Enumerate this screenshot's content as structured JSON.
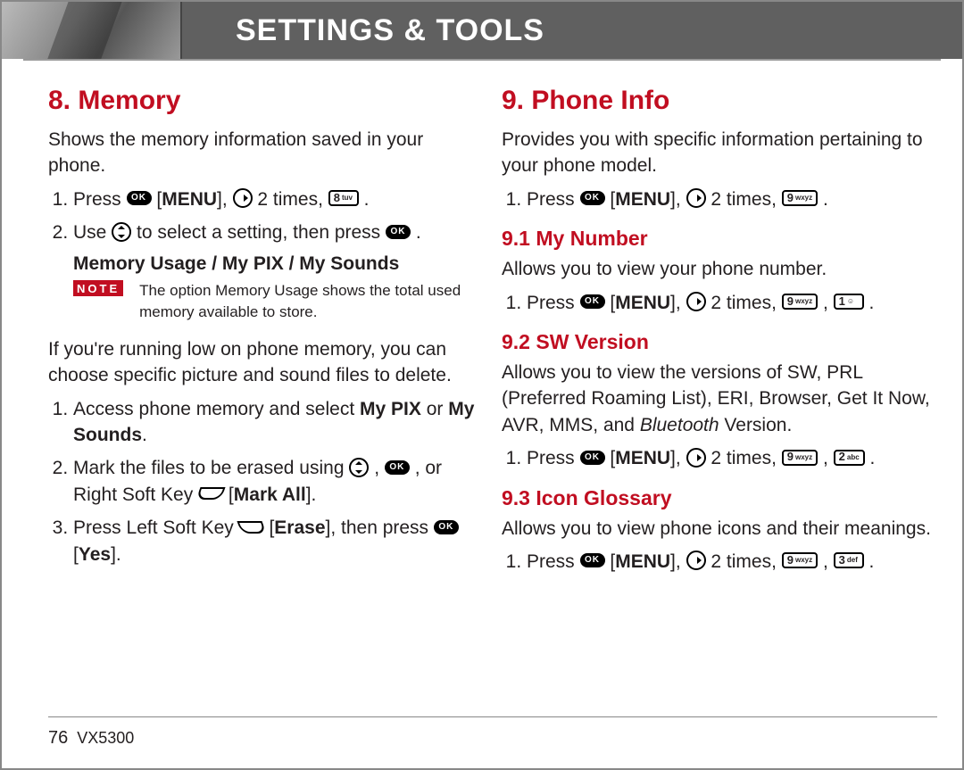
{
  "header": {
    "title": "SETTINGS & TOOLS"
  },
  "footer": {
    "page": "76",
    "model": "VX5300"
  },
  "keys": {
    "ok": "OK",
    "k8": {
      "digit": "8",
      "letters": "tuv"
    },
    "k9": {
      "digit": "9",
      "letters": "wxyz"
    },
    "k1": {
      "digit": "1",
      "letters": ""
    },
    "k2": {
      "digit": "2",
      "letters": "abc"
    },
    "k3": {
      "digit": "3",
      "letters": "def"
    }
  },
  "left": {
    "h": "8. Memory",
    "intro": "Shows the memory information saved in your phone.",
    "s1_a": "Press ",
    "s1_b": " [",
    "s1_menu": "MENU",
    "s1_c": "],   ",
    "s1_d": "  2 times,  ",
    "s1_e": " .",
    "s2_a": "Use  ",
    "s2_b": "  to select a setting, then press ",
    "s2_c": " .",
    "opts": "Memory Usage / My PIX / My Sounds",
    "note_label": "NOTE",
    "note": "The option Memory Usage shows the total used memory available to store.",
    "lowmem": "If you're running low on phone memory, you can choose specific picture and sound files to delete.",
    "d1_a": "Access phone memory and select ",
    "d1_b": "My PIX",
    "d1_c": " or ",
    "d1_d": "My Sounds",
    "d1_e": ".",
    "d2_a": "Mark the files to be erased using  ",
    "d2_b": " ,  ",
    "d2_c": " , or Right Soft Key ",
    "d2_d": " [",
    "d2_mark": "Mark All",
    "d2_e": "].",
    "d3_a": "Press Left Soft Key ",
    "d3_b": " [",
    "d3_erase": "Erase",
    "d3_c": "], then press ",
    "d3_d": " [",
    "d3_yes": "Yes",
    "d3_e": "]."
  },
  "right": {
    "h": "9. Phone Info",
    "intro": "Provides you with specific information pertaining to your phone model.",
    "s1_a": "Press ",
    "s1_menu": "MENU",
    "s1_b": " [",
    "s1_c": "],   ",
    "s1_d": "  2 times,  ",
    "s1_e": " .",
    "h91": "9.1 My Number",
    "p91": "Allows you to view your phone number.",
    "h92": "9.2 SW Version",
    "p92_a": "Allows you to view the versions of SW, PRL (Preferred Roaming List), ERI, Browser, Get It Now, AVR, MMS, and ",
    "p92_bt": "Bluetooth",
    "p92_b": " Version.",
    "h93": "9.3 Icon Glossary",
    "p93": "Allows you to view phone icons and their meanings."
  }
}
